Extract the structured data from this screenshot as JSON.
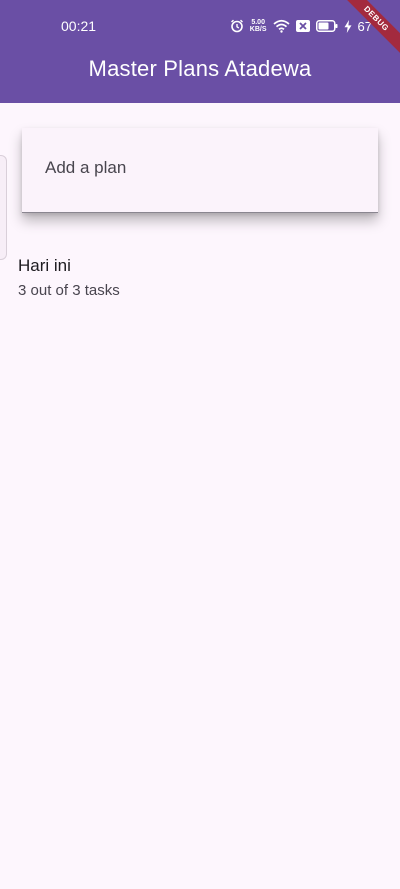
{
  "status_bar": {
    "time": "00:21",
    "net_speed_value": "5.00",
    "net_speed_unit": "KB/S",
    "battery_percent": "67",
    "icons": [
      "alarm-icon",
      "wifi-icon",
      "no-sim-icon",
      "battery-icon",
      "charging-icon"
    ]
  },
  "app_bar": {
    "title": "Master Plans Atadewa"
  },
  "debug_banner": {
    "label": "DEBUG"
  },
  "add_plan": {
    "placeholder": "Add a plan",
    "value": ""
  },
  "plans": [
    {
      "title": "Hari ini",
      "subtitle": "3 out of 3 tasks"
    }
  ],
  "colors": {
    "app_bar": "#6a4fa5",
    "background": "#fdf6fd",
    "debug_ribbon": "#a32a3e"
  }
}
